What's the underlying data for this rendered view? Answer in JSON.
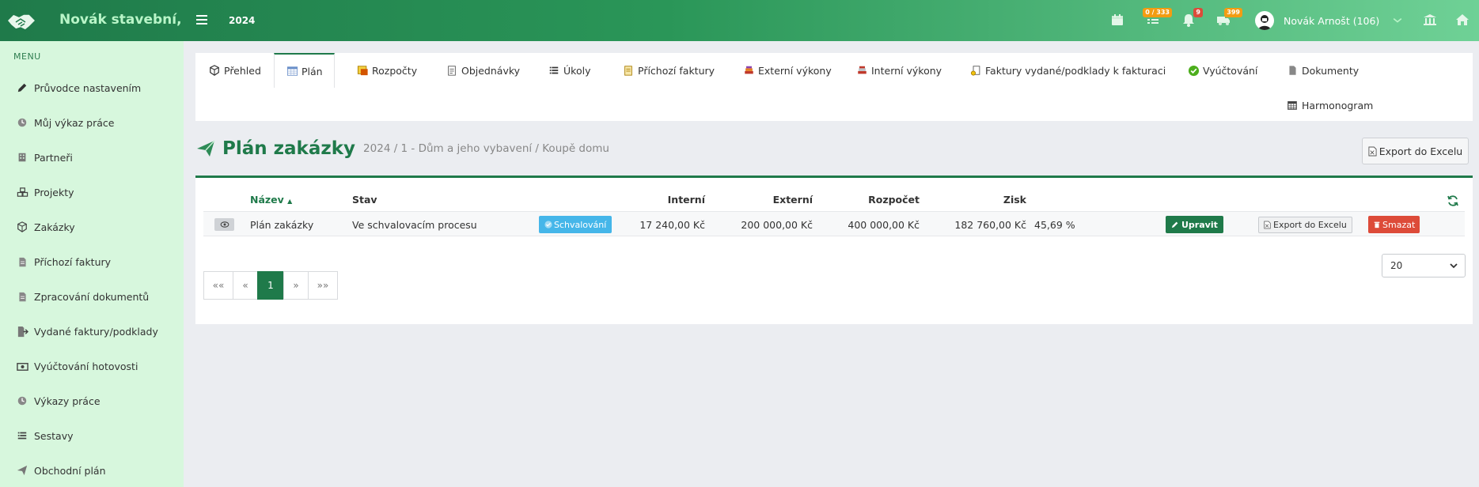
{
  "navbar": {
    "brand": "Novák stavební,",
    "year": "2024",
    "tasks_badge": "0 / 333",
    "notifications_badge": "9",
    "messages_badge": "399",
    "user": "Novák Arnošt (106)",
    "badge_colors": {
      "orange": "#f39c12",
      "red": "#dd4b39"
    }
  },
  "sidebar": {
    "header": "MENU",
    "items": [
      {
        "label": "Průvodce nastavením",
        "icon": "pencil-icon"
      },
      {
        "label": "Můj výkaz práce",
        "icon": "clock-icon"
      },
      {
        "label": "Partneři",
        "icon": "building-icon"
      },
      {
        "label": "Projekty",
        "icon": "cubes-icon"
      },
      {
        "label": "Zakázky",
        "icon": "cube-icon"
      },
      {
        "label": "Příchozí faktury",
        "icon": "file-icon"
      },
      {
        "label": "Zpracování dokumentů",
        "icon": "file-icon"
      },
      {
        "label": "Vydané faktury/podklady",
        "icon": "export-file-icon"
      },
      {
        "label": "Vyúčtování hotovosti",
        "icon": "money-icon"
      },
      {
        "label": "Výkazy práce",
        "icon": "clock-icon"
      },
      {
        "label": "Sestavy",
        "icon": "list-icon"
      },
      {
        "label": "Obchodní plán",
        "icon": "paper-plane-icon"
      }
    ]
  },
  "tabs": [
    {
      "label": "Přehled"
    },
    {
      "label": "Plán"
    },
    {
      "label": "Rozpočty"
    },
    {
      "label": "Objednávky"
    },
    {
      "label": "Úkoly"
    },
    {
      "label": "Příchozí faktury"
    },
    {
      "label": "Externí výkony"
    },
    {
      "label": "Interní výkony"
    },
    {
      "label": "Faktury vydané/podklady k fakturaci"
    },
    {
      "label": "Vyúčtování"
    },
    {
      "label": "Dokumenty"
    },
    {
      "label": "Harmonogram"
    }
  ],
  "page": {
    "title": "Plán zakázky",
    "subtitle": "2024 / 1 - Dům a jeho vybavení / Koupě domu",
    "export_label": "Export do Excelu"
  },
  "table": {
    "headers": {
      "name": "Název",
      "status": "Stav",
      "internal": "Interní",
      "external": "Externí",
      "budget": "Rozpočet",
      "profit": "Zisk"
    },
    "row": {
      "name": "Plán zakázky",
      "status": "Ve schvalovacím procesu",
      "status_badge": "Schvalování",
      "internal": "17 240,00 Kč",
      "external": "200 000,00 Kč",
      "budget": "400 000,00 Kč",
      "profit": "182 760,00 Kč",
      "profit_pct": "45,69 %",
      "edit_label": "Upravit",
      "export_label": "Export do Excelu",
      "delete_label": "Smazat"
    }
  },
  "pagination": {
    "first": "««",
    "prev": "«",
    "current": "1",
    "next": "»",
    "last": "»»",
    "page_size": "20"
  }
}
